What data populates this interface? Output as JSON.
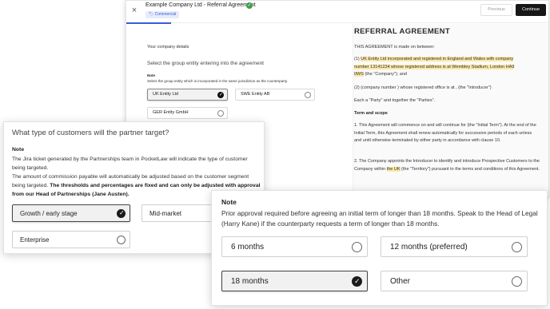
{
  "window": {
    "close_label": "×",
    "title": "Example Company Ltd - Referral Agreement",
    "check_glyph": "✓",
    "badge": "🏷 Commercial",
    "previous_label": "Previous",
    "continue_label": "Continue"
  },
  "form": {
    "section_label": "Your company details",
    "question": "Select the group entity entering into the agreement",
    "note_heading": "Note",
    "note_text": "Select the group entity which is incorporated in the same jurisdiction as the counterparty.",
    "options": [
      {
        "label": "UK Entity Ltd",
        "selected": true
      },
      {
        "label": "SWE Entity AB",
        "selected": false
      },
      {
        "label": "GER Entity GmbH",
        "selected": false
      }
    ]
  },
  "document": {
    "title": "REFERRAL AGREEMENT",
    "intro": "THIS AGREEMENT is made on between:",
    "party1_prefix": "(1) ",
    "party1_highlight": "UK Entity Ltd incorporated and registered in England and Wales with company number 13141234 whose registered address is at Wembley Stadium, London HA9 0WS",
    "party1_suffix": " (the \"Company\"); and",
    "party2": "(2) (company number ) whose registered office is at , (the \"Introducer\")",
    "parties": "Each a \"Party\" and together the \"Parties\".",
    "section_heading": "Term and scope",
    "clause1": "1.  This Agreement will commence on and will continue for (the \"Initial Term\"). At the end of the Initial Term, this Agreement shall renew automatically for successive periods of each unless and until otherwise terminated by either party in accordance with clause 10.",
    "clause2_prefix": "2.  The Company appoints the Introducer to identify and introduce Prospective Customers to the Company within ",
    "clause2_highlight": "the UK",
    "clause2_suffix": " (the \"Territory\") pursuant to the terms and conditions of this Agreement."
  },
  "customers_card": {
    "question": "What type of customers will the partner target?",
    "note_heading": "Note",
    "note_line1": "The Jira ticket generated by the Partnerships team in PocketLaw will indicate the type of customer being targeted.",
    "note_line2_plain": "The amount of commission payable will automatically be adjusted based on the customer segment being targeted. ",
    "note_line2_bold": "The thresholds and percentages are fixed and can only be adjusted with approval from our Head of Partnerships (Jane Austen).",
    "options": [
      {
        "label": "Growth / early stage",
        "selected": true
      },
      {
        "label": "Mid-market",
        "selected": false
      },
      {
        "label": "Enterprise",
        "selected": false
      }
    ]
  },
  "term_card": {
    "note_heading": "Note",
    "note_text": "Prior approval required before agreeing an initial term of longer than 18 months. Speak to the Head of Legal (Harry Kane) if the counterparty requests a term of longer than 18 months.",
    "options": [
      {
        "label": "6 months",
        "selected": false
      },
      {
        "label": "12 months (preferred)",
        "selected": false
      },
      {
        "label": "18 months",
        "selected": true
      },
      {
        "label": "Other",
        "selected": false
      }
    ]
  }
}
